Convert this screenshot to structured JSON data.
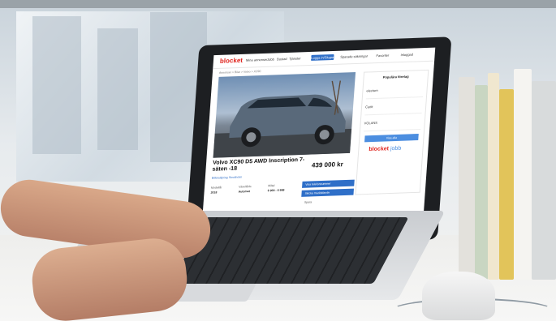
{
  "photo": {
    "subject": "Laptop on a desk showing a Blocket car listing",
    "screen": {
      "logo": "blocket",
      "nav_items": [
        "Mina annonser",
        "Jobb",
        "Bostad",
        "Tjänster"
      ],
      "login_label": "Logga in/Skapa",
      "right_items": [
        "Sparade sökningar",
        "Favoriter",
        "Inloggad"
      ],
      "breadcrumb": "Annonser > Bilar > Volvo > XC90",
      "listing_title": "Volvo XC90 D5 AWD Inscription 7-säten -18",
      "price": "439 000 kr",
      "seller_link": "Bilförsäljning Stockholm",
      "specs": [
        {
          "label": "Modellår",
          "value": "2018"
        },
        {
          "label": "Växellåda",
          "value": "Automat"
        },
        {
          "label": "Miltal",
          "value": "6 900 - 6 999"
        }
      ],
      "buttons": [
        "Visa telefonnummer",
        "Skicka meddelande"
      ],
      "favorite_label": "Spara",
      "sidebar": {
        "heading": "Populära företag",
        "items": [
          "electurn",
          "Curlit",
          "VOLANS"
        ],
        "cta": "Visa alla",
        "jobb_logo_a": "blocket",
        "jobb_logo_b": "jobb"
      }
    }
  },
  "colors": {
    "blocket_red": "#e0261f",
    "blocket_blue": "#2f6fc8",
    "laptop_bezel": "#1d1f22",
    "desk": "#f4f4f2"
  }
}
